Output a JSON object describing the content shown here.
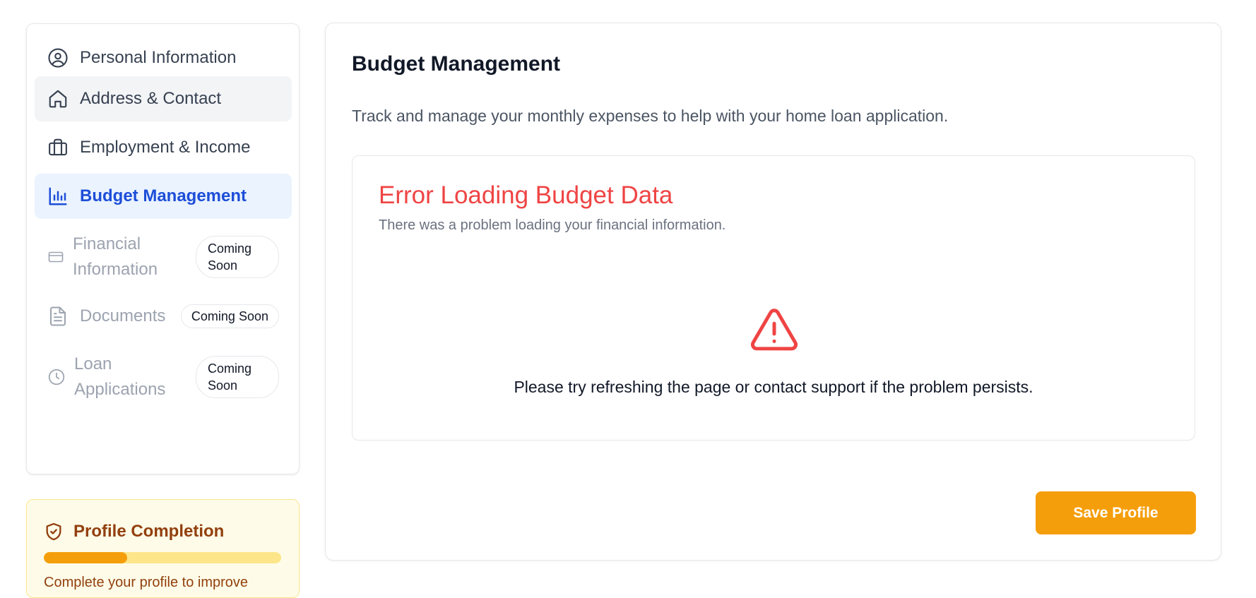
{
  "sidebar": {
    "items": [
      {
        "label": "Personal Information",
        "icon": "user-circle-icon",
        "state": "normal"
      },
      {
        "label": "Address & Contact",
        "icon": "home-icon",
        "state": "hover"
      },
      {
        "label": "Employment & Income",
        "icon": "briefcase-icon",
        "state": "normal"
      },
      {
        "label": "Budget Management",
        "icon": "bar-chart-icon",
        "state": "active"
      },
      {
        "label_line1": "Financial",
        "label_line2": "Information",
        "icon": "credit-card-icon",
        "state": "disabled",
        "badge_line1": "Coming",
        "badge_line2": "Soon"
      },
      {
        "label": "Documents",
        "icon": "file-icon",
        "state": "disabled",
        "badge": "Coming Soon"
      },
      {
        "label_line1": "Loan",
        "label_line2": "Applications",
        "icon": "clock-icon",
        "state": "disabled",
        "badge_line1": "Coming",
        "badge_line2": "Soon"
      }
    ]
  },
  "profile_completion": {
    "title": "Profile Completion",
    "icon": "shield-check-icon",
    "progress": 0.35,
    "text": "Complete your profile to improve"
  },
  "main": {
    "title": "Budget Management",
    "description": "Track and manage your monthly expenses to help with your home loan application.",
    "error": {
      "title": "Error Loading Budget Data",
      "subtitle": "There was a problem loading your financial information.",
      "icon": "warning-triangle-icon",
      "message": "Please try refreshing the page or contact support if the problem persists."
    },
    "save_label": "Save Profile"
  },
  "colors": {
    "accent": "#1d4ed8",
    "active_bg": "#eaf3fe",
    "error": "#ef4444",
    "primary_button": "#f59e0b",
    "warning_bg": "#fefce8"
  }
}
